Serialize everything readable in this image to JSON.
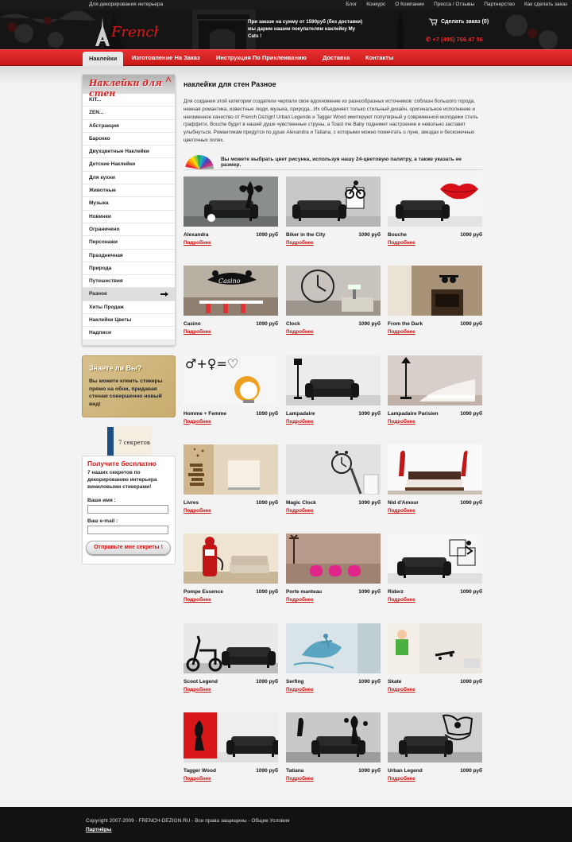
{
  "topbar": {
    "tagline": "Для декорирования интерьера",
    "links": [
      "Блог",
      "Конкурс",
      "О Компании",
      "Пресса / Отзывы",
      "Партнерство",
      "Как сделать заказ"
    ]
  },
  "header": {
    "logo": "French Dezign",
    "promo": "При заказе на сумму от 1590руб (без доставки) мы дарим нашим покупателям наклейку My Cats !",
    "cart": "Сделать заказ (0)",
    "phone": "+7 (495) 766 47 56"
  },
  "nav": {
    "items": [
      "Наклейки",
      "Изготовление На Заказ",
      "Инструкция По Приклеиванию",
      "Доставка",
      "Контакты"
    ],
    "active": "Наклейки"
  },
  "sidebar": {
    "title": "Наклейки для стен",
    "items": [
      "KIT...",
      "ZEN...",
      "Абстракция",
      "Барокко",
      "Двухцветные Наклейки",
      "Детские Наклейки",
      "Для кухни",
      "Животные",
      "Музыка",
      "Новинки",
      "Ограничено",
      "Персонажи",
      "Праздничная",
      "Природа",
      "Путешествия",
      "Разное",
      "Хиты Продаж",
      "Наклейки Цветы",
      "Надписи"
    ],
    "active": "Разное"
  },
  "know": {
    "title": "Знаете ли Вы?",
    "text": "Вы можете клеить стикеры прямо на обои, придавая стенам совершенно новый вид!"
  },
  "secrets": {
    "book_label": "7 секретов",
    "title": "Получите бесплатно",
    "text": "7 наших секретов по декорированию интерьера виниловыми стикерами!",
    "name_label": "Ваше имя :",
    "email_label": "Ваш e-mail :",
    "button": "Отправьте мне секреты !"
  },
  "main": {
    "title": "наклейки для стен Разное",
    "description": "Для создания этой категории создатели черпали свое вдохновение из разнообразных источников: соблазн большого города, нежная романтика, известные люди, музыка, природа...Их объединяет только стильный дизайн, оригинальное исполнение и неизменное качество от French Dezign! Urban Legende и Tagger Wood имитируют популярный у современной молодежи стиль граффити, Bouche будит в нашей душе чувственные струны, а Toast me Baby поднимет настроение и невольно заставит улыбнуться. Романтикам придутся по душе Alexandra и Tatiana, с которыми можно помечтать о луне, звездах и бесконечных цветочных полях.",
    "palette_note": "Вы можете выбрать цвет рисунка, используя нашу 24-цветовую палитру, а также указать ее размер.",
    "more_label": "Подробнее"
  },
  "products": [
    {
      "name": "Alexandra",
      "price": "1090 руб",
      "art": "fairy",
      "bg": "#8a8f8c"
    },
    {
      "name": "Biker in the City",
      "price": "1090 руб",
      "art": "biker",
      "bg": "#c9c9c9"
    },
    {
      "name": "Bouche",
      "price": "1090 руб",
      "art": "lips",
      "bg": "#f4f4f4"
    },
    {
      "name": "Casino",
      "price": "1090 руб",
      "art": "casino",
      "bg": "#b9b0a4"
    },
    {
      "name": "Clock",
      "price": "1090 руб",
      "art": "clock",
      "bg": "#c8c4bd"
    },
    {
      "name": "From the Dark",
      "price": "1090 руб",
      "art": "dark",
      "bg": "#a89278"
    },
    {
      "name": "Homme + Femme",
      "price": "1090 руб",
      "art": "symbols",
      "bg": "#f6f6f6"
    },
    {
      "name": "Lampadaire",
      "price": "1090 руб",
      "art": "lamp",
      "bg": "#ececec"
    },
    {
      "name": "Lampadaire Parisien",
      "price": "1090 руб",
      "art": "lamp2",
      "bg": "#d9cfca"
    },
    {
      "name": "Livres",
      "price": "1090 руб",
      "art": "books",
      "bg": "#e4d6bf"
    },
    {
      "name": "Magic Clock",
      "price": "1090 руб",
      "art": "magic",
      "bg": "#e2e2e2"
    },
    {
      "name": "Nid d'Amour",
      "price": "1090 руб",
      "art": "nid",
      "bg": "#fafafa"
    },
    {
      "name": "Pompe Essence",
      "price": "1090 руб",
      "art": "pump",
      "bg": "#efe4cf"
    },
    {
      "name": "Porte manteau",
      "price": "1090 руб",
      "art": "coat",
      "bg": "#b89a8a"
    },
    {
      "name": "Riderz",
      "price": "1090 руб",
      "art": "riderz",
      "bg": "#f6f6f6"
    },
    {
      "name": "Scoot Legend",
      "price": "1090 руб",
      "art": "scooter",
      "bg": "#e9e9e9"
    },
    {
      "name": "Serfing",
      "price": "1090 руб",
      "art": "surf",
      "bg": "#d8e4e8"
    },
    {
      "name": "Skate",
      "price": "1090 руб",
      "art": "skate",
      "bg": "#ebe6df"
    },
    {
      "name": "Tagger Wood",
      "price": "1090 руб",
      "art": "tagger",
      "bg": "#eeeeee"
    },
    {
      "name": "Tatiana",
      "price": "1090 руб",
      "art": "tatiana",
      "bg": "#c9c9c9"
    },
    {
      "name": "Urban Legend",
      "price": "1090 руб",
      "art": "urban",
      "bg": "#d0d0d0"
    }
  ],
  "footer": {
    "copyright": "Copyright 2007-2009 - FRENCH-DEZIGN.RU - Все права защищены - Общие Условия",
    "partners": "Партнёры"
  },
  "colors": {
    "accent": "#d61c1c",
    "nav": "#d42020",
    "dark": "#151515"
  }
}
